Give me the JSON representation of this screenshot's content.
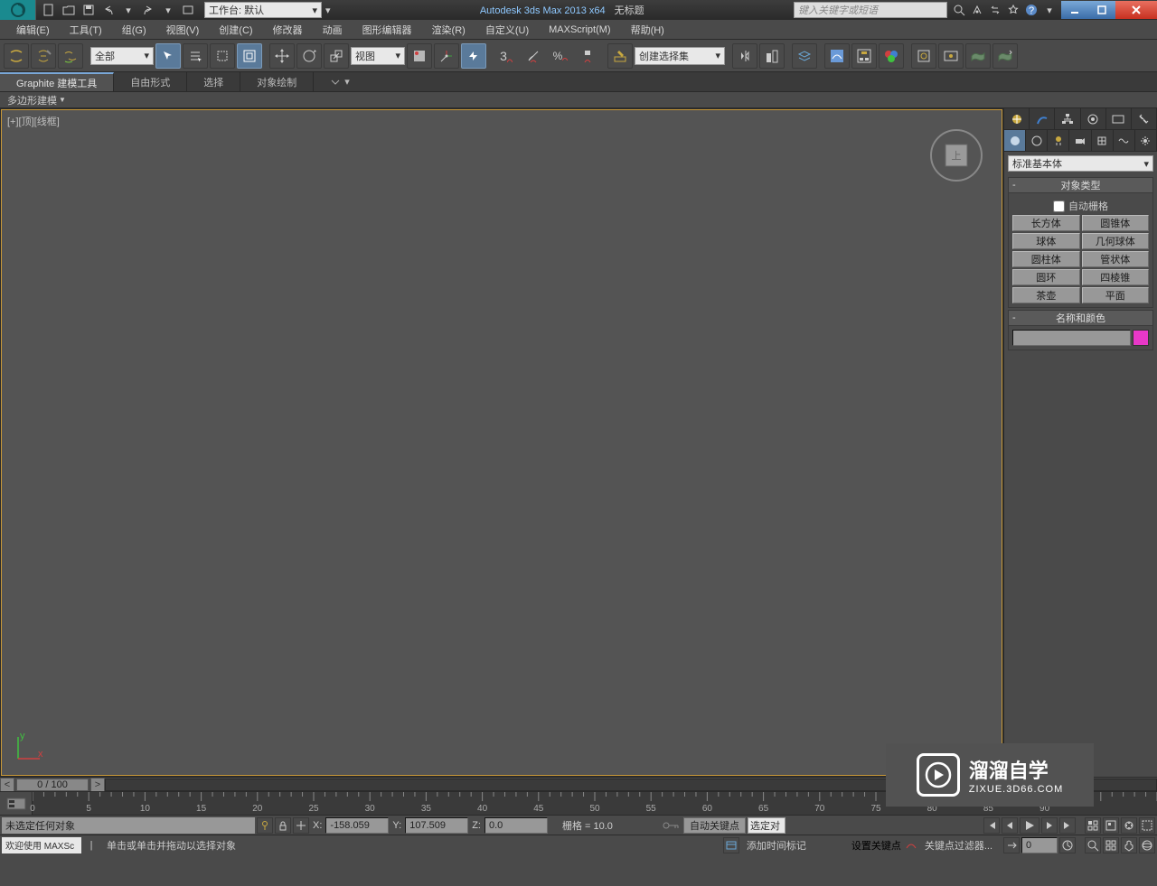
{
  "title": {
    "app": "Autodesk 3ds Max  2013 x64",
    "doc": "无标题"
  },
  "workspace": "工作台: 默认",
  "search_placeholder": "键入关键字或短语",
  "menus": [
    "编辑(E)",
    "工具(T)",
    "组(G)",
    "视图(V)",
    "创建(C)",
    "修改器",
    "动画",
    "图形编辑器",
    "渲染(R)",
    "自定义(U)",
    "MAXScript(M)",
    "帮助(H)"
  ],
  "toolbar": {
    "filter_combo": "全部",
    "refcoord_combo": "视图",
    "named_sel_combo": "创建选择集",
    "snap_text": "3"
  },
  "ribbon": {
    "tabs": [
      "Graphite 建模工具",
      "自由形式",
      "选择",
      "对象绘制"
    ],
    "subtab": "多边形建模"
  },
  "viewport_label": "[+][顶][线框]",
  "command_panel": {
    "category": "标准基本体",
    "rollout_objtype": "对象类型",
    "autogrid": "自动栅格",
    "objects": [
      "长方体",
      "圆锥体",
      "球体",
      "几何球体",
      "圆柱体",
      "管状体",
      "圆环",
      "四棱锥",
      "茶壶",
      "平面"
    ],
    "rollout_namecolor": "名称和颜色"
  },
  "time": {
    "slider": "0 / 100"
  },
  "ruler_numbers": [
    0,
    5,
    10,
    15,
    20,
    25,
    30,
    35,
    40,
    45,
    50,
    55,
    60,
    65,
    70,
    75,
    80,
    85,
    90
  ],
  "status": {
    "selection": "未选定任何对象",
    "x": "-158.059",
    "y": "107.509",
    "z": "0.0",
    "xl": "X:",
    "yl": "Y:",
    "zl": "Z:",
    "grid": "栅格 = 10.0",
    "autokey": "自动关键点",
    "selset": "选定对",
    "setkey": "设置关键点",
    "keyfilter": "关键点过滤器...",
    "frame": "0",
    "welcome": "欢迎使用 MAXSc",
    "prompt": "单击或单击并拖动以选择对象",
    "add_time_tag": "添加时间标记"
  },
  "watermark": {
    "big": "溜溜自学",
    "small": "ZIXUE.3D66.COM"
  }
}
